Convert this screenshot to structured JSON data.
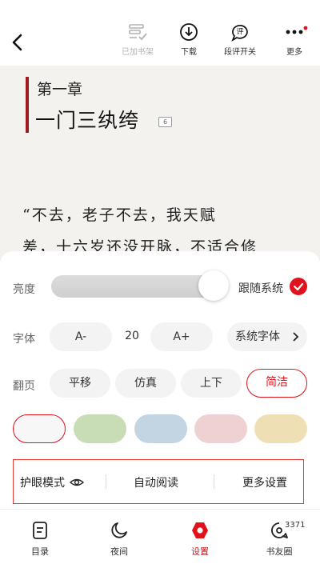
{
  "toolbar": {
    "items": [
      {
        "label": "已加书架",
        "icon": "bookshelf-check-icon"
      },
      {
        "label": "下载",
        "icon": "download-icon"
      },
      {
        "label": "段评开关",
        "icon": "comment-toggle-icon"
      },
      {
        "label": "更多",
        "icon": "more-icon"
      }
    ]
  },
  "chapter": {
    "number": "第一章",
    "title": "一门三纨绔",
    "badge": "6",
    "lines": [
      "“不去，老子不去，我天赋",
      "差，十六岁还没开脉，不适合修"
    ]
  },
  "settings": {
    "brightness": {
      "label": "亮度",
      "follow_label": "跟随系统",
      "value": 0.9
    },
    "font": {
      "label": "字体",
      "decrease": "A-",
      "size": "20",
      "increase": "A+",
      "family": "系统字体"
    },
    "page_turn": {
      "label": "翻页",
      "options": [
        "平移",
        "仿真",
        "上下",
        "简洁"
      ],
      "selected": "简洁"
    },
    "backgrounds": [
      "#f7f7f7",
      "#c8dcb6",
      "#c3d5e3",
      "#efd1d3",
      "#efdfb5"
    ],
    "bottom": {
      "eye_mode": "护眼模式",
      "auto_read": "自动阅读",
      "more": "更多设置"
    }
  },
  "nav": {
    "items": [
      {
        "label": "目录",
        "icon": "catalog-icon"
      },
      {
        "label": "夜间",
        "icon": "moon-icon"
      },
      {
        "label": "设置",
        "icon": "settings-icon"
      },
      {
        "label": "书友圈",
        "icon": "community-icon"
      }
    ],
    "badge": "3371"
  },
  "colors": {
    "accent": "#e0121c",
    "chapter_bar": "#9f1b1f"
  }
}
